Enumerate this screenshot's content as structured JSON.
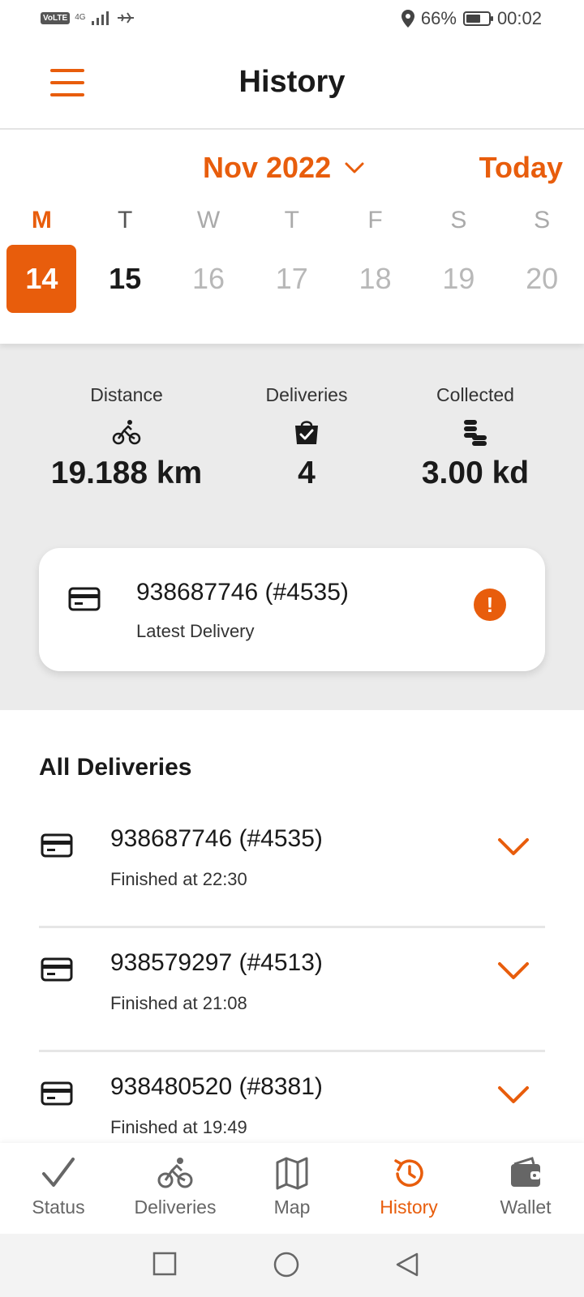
{
  "status_bar": {
    "network": "4G",
    "volte": "VoLTE",
    "battery": "66%",
    "battery_level": 0.66,
    "time": "00:02"
  },
  "header": {
    "title": "History",
    "menu_icon": "hamburger-icon"
  },
  "calendar": {
    "month": "Nov 2022",
    "today_label": "Today",
    "days": [
      {
        "weekday": "M",
        "date": "14"
      },
      {
        "weekday": "T",
        "date": "15"
      },
      {
        "weekday": "W",
        "date": "16"
      },
      {
        "weekday": "T",
        "date": "17"
      },
      {
        "weekday": "F",
        "date": "18"
      },
      {
        "weekday": "S",
        "date": "19"
      },
      {
        "weekday": "S",
        "date": "20"
      }
    ],
    "selected_date": "14"
  },
  "stats": {
    "distance": {
      "label": "Distance",
      "value": "19.188 km",
      "icon": "bicycle-icon"
    },
    "deliveries": {
      "label": "Deliveries",
      "value": "4",
      "icon": "shopping-bag-icon"
    },
    "collected": {
      "label": "Collected",
      "value": "3.00 kd",
      "icon": "coins-icon"
    }
  },
  "latest": {
    "id": "938687746 (#4535)",
    "subtitle": "Latest Delivery"
  },
  "all_deliveries": {
    "title": "All Deliveries",
    "items": [
      {
        "id": "938687746 (#4535)",
        "status": "Finished at 22:30"
      },
      {
        "id": "938579297 (#4513)",
        "status": "Finished at 21:08"
      },
      {
        "id": "938480520 (#8381)",
        "status": "Finished at 19:49"
      }
    ]
  },
  "nav": {
    "items": [
      {
        "label": "Status",
        "icon": "checkmark-icon"
      },
      {
        "label": "Deliveries",
        "icon": "bicycle-icon"
      },
      {
        "label": "Map",
        "icon": "map-icon"
      },
      {
        "label": "History",
        "icon": "history-icon"
      },
      {
        "label": "Wallet",
        "icon": "wallet-icon"
      }
    ],
    "active": "History"
  },
  "colors": {
    "accent": "#e85d0c",
    "background_stats": "#ebebeb"
  }
}
